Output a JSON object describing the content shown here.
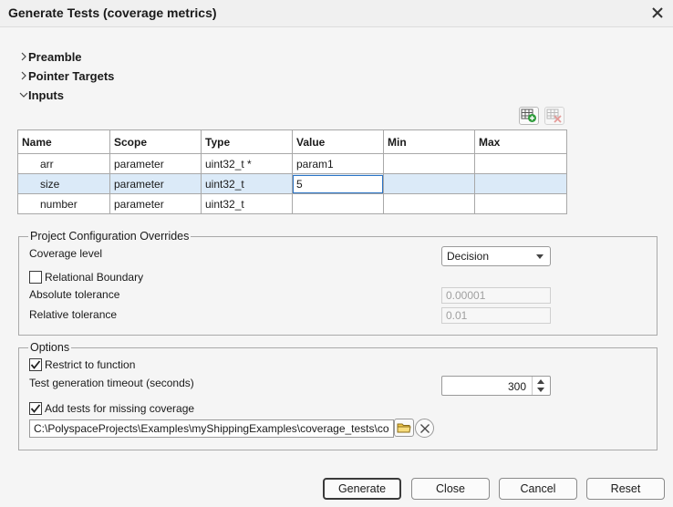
{
  "window": {
    "title": "Generate Tests (coverage metrics)"
  },
  "sections": {
    "preamble": "Preamble",
    "pointer_targets": "Pointer Targets",
    "inputs": "Inputs"
  },
  "table": {
    "columns": [
      "Name",
      "Scope",
      "Type",
      "Value",
      "Min",
      "Max"
    ],
    "rows": [
      {
        "name": "arr",
        "scope": "parameter",
        "type": "uint32_t *",
        "value": "param1",
        "min": "",
        "max": ""
      },
      {
        "name": "size",
        "scope": "parameter",
        "type": "uint32_t",
        "value": "5",
        "min": "",
        "max": ""
      },
      {
        "name": "number",
        "scope": "parameter",
        "type": "uint32_t",
        "value": "",
        "min": "",
        "max": ""
      }
    ]
  },
  "overrides": {
    "legend": "Project Configuration Overrides",
    "coverage_level_label": "Coverage level",
    "coverage_level_value": "Decision",
    "relational_boundary_label": "Relational Boundary",
    "relational_boundary_checked": false,
    "absolute_tolerance_label": "Absolute tolerance",
    "absolute_tolerance_value": "0.00001",
    "relative_tolerance_label": "Relative tolerance",
    "relative_tolerance_value": "0.01"
  },
  "options": {
    "legend": "Options",
    "restrict_label": "Restrict to function",
    "restrict_checked": true,
    "timeout_label": "Test generation timeout (seconds)",
    "timeout_value": "300",
    "missing_coverage_label": "Add tests for missing coverage",
    "missing_coverage_checked": true,
    "path_value": "C:\\PolyspaceProjects\\Examples\\myShippingExamples\\coverage_tests\\co"
  },
  "buttons": {
    "generate": "Generate",
    "close": "Close",
    "cancel": "Cancel",
    "reset": "Reset"
  },
  "icons": {
    "add_row": "table-add-icon",
    "remove_row": "table-remove-icon",
    "folder": "folder-icon",
    "clear": "clear-icon",
    "close": "close-icon"
  },
  "colors": {
    "selected_row": "#dbeaf8",
    "edit_border": "#2a73c5",
    "add_green": "#2e9b3a",
    "remove_red": "#d9534f",
    "folder_yellow": "#f2c94c"
  }
}
